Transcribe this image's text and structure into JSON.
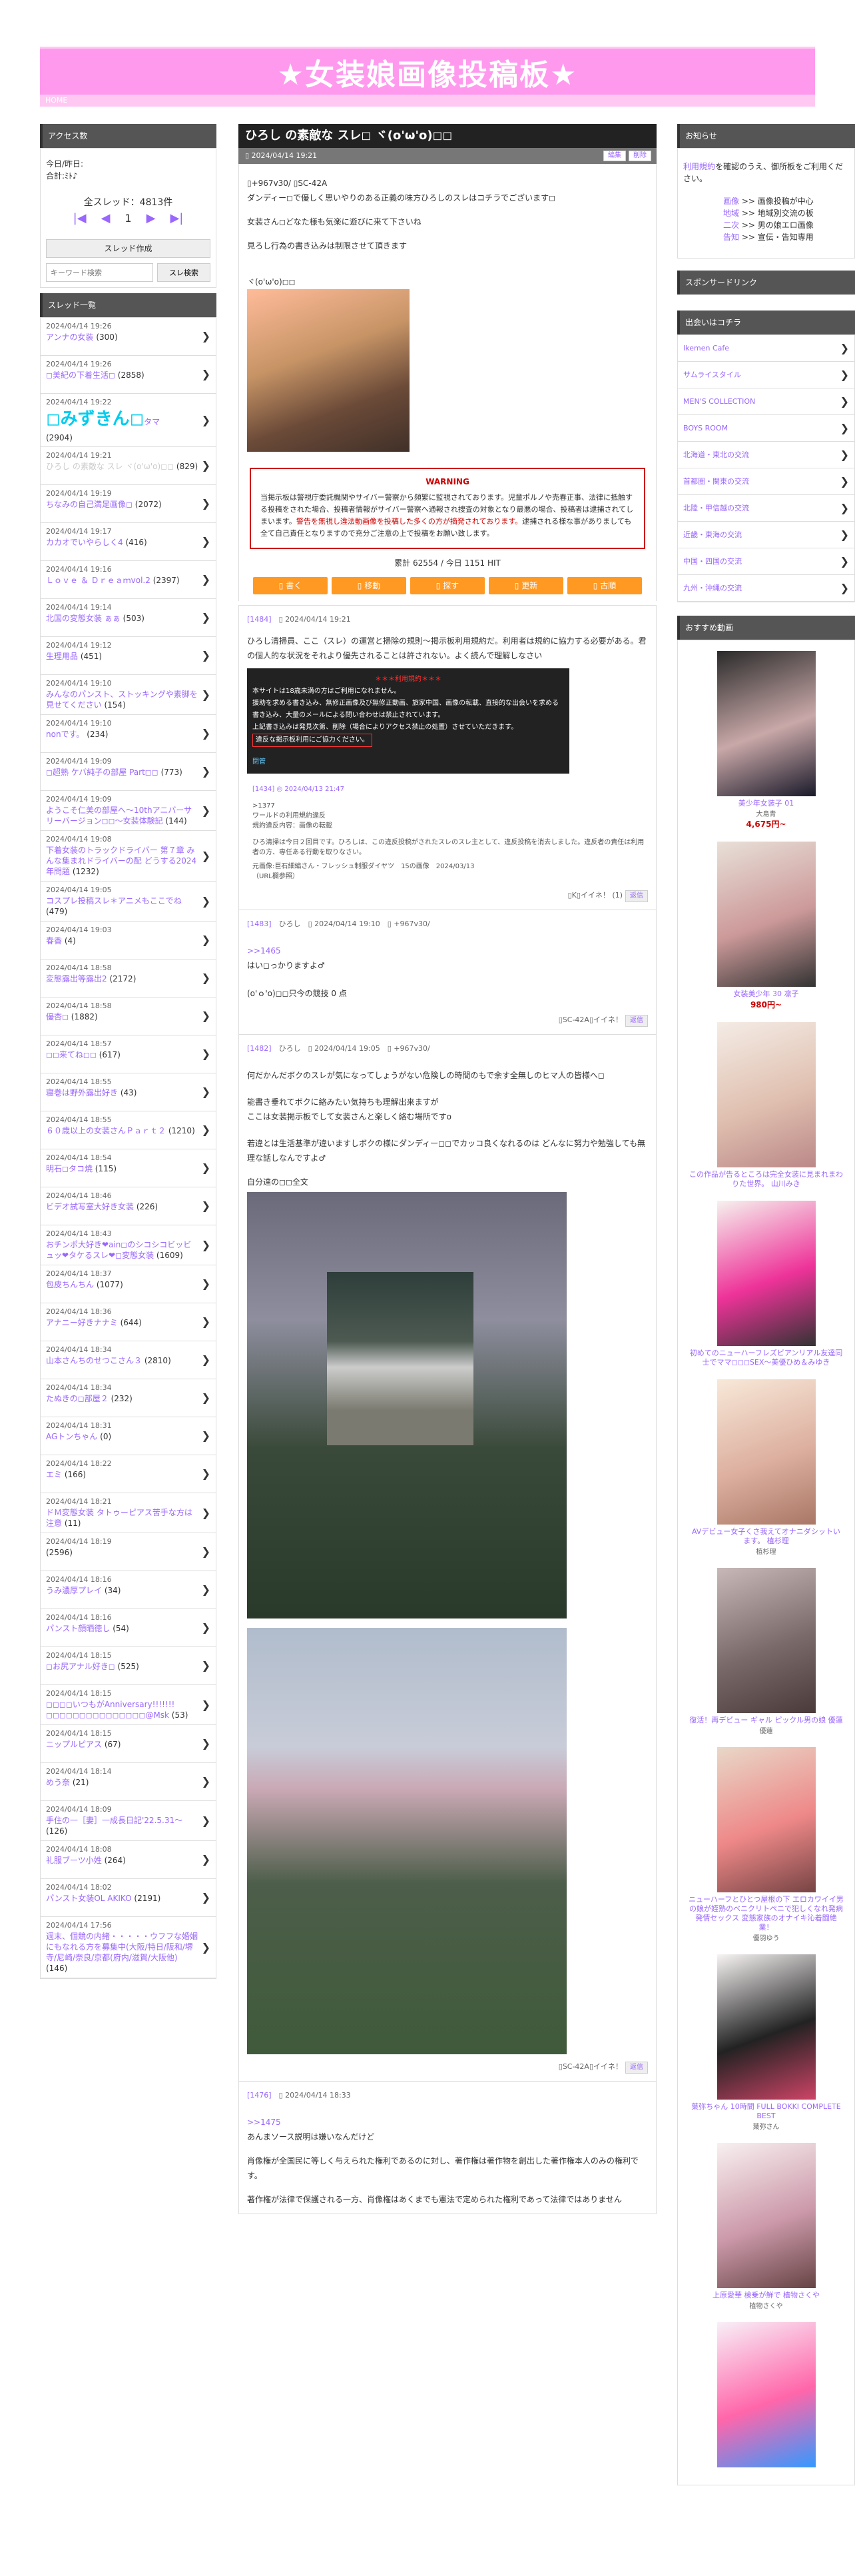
{
  "site": {
    "banner": "★女装娘画像投稿板★",
    "home": "HOME"
  },
  "left": {
    "access_title": "アクセス数",
    "access_today": "今日/昨日:",
    "access_total": "合計:ﾐﾄ♪",
    "all_threads": "全スレッド：4813件",
    "page_num": "1",
    "create_btn": "スレッド作成",
    "search_placeholder": "キーワード検索",
    "search_btn": "スレ検索",
    "list_title": "スレッド一覧",
    "threads": [
      {
        "date": "2024/04/14 19:26",
        "title": "アンナの女装",
        "count": "(300)"
      },
      {
        "date": "2024/04/14 19:26",
        "title": "◻︎美紀の下着生活◻︎",
        "count": "(2858)"
      },
      {
        "date": "2024/04/14 19:22",
        "title": "◻︎みずきん◻︎",
        "title_tail": "タマ",
        "count": "(2904)",
        "big": true
      },
      {
        "date": "2024/04/14 19:21",
        "title": "ひろし の素敵な スレ ヾ(o'ω'o)◻︎◻︎",
        "count": "(829)",
        "grey": true
      },
      {
        "date": "2024/04/14 19:19",
        "title": "ちなみの自己満足画像◻︎",
        "count": "(2072)"
      },
      {
        "date": "2024/04/14 19:17",
        "title": "カカオでいやらしく4",
        "count": "(416)"
      },
      {
        "date": "2024/04/14 19:16",
        "title": "Ｌｏｖｅ ＆ Ｄｒｅａｍvol.2",
        "count": "(2397)"
      },
      {
        "date": "2024/04/14 19:14",
        "title": "北国の変態女装 ぁぁ",
        "count": "(503)"
      },
      {
        "date": "2024/04/14 19:12",
        "title": "生理用品",
        "count": "(451)"
      },
      {
        "date": "2024/04/14 19:10",
        "title": "みんなのパンスト、ストッキングや素脚を見せてください",
        "count": "(154)"
      },
      {
        "date": "2024/04/14 19:10",
        "title": "nonです。",
        "count": "(234)"
      },
      {
        "date": "2024/04/14 19:09",
        "title": "◻︎超熟 ケバ純子の部屋 Part◻︎◻︎",
        "count": "(773)"
      },
      {
        "date": "2024/04/14 19:09",
        "title": "ようこそ仁美の部屋へ〜10thアニバーサリーバージョン◻︎◻︎〜女装体験記",
        "count": "(144)"
      },
      {
        "date": "2024/04/14 19:08",
        "title": "下着女装のトラックドライバー 第７章 みんな集まれドライバーの配 どうする2024年問題",
        "count": "(1232)"
      },
      {
        "date": "2024/04/14 19:05",
        "title": "コスプレ投稿スレ",
        "title_tail": "＊アニメもここでね",
        "count": "(479)"
      },
      {
        "date": "2024/04/14 19:03",
        "title": "春香",
        "count": "(4)"
      },
      {
        "date": "2024/04/14 18:58",
        "title": "変態露出等露出2",
        "count": "(2172)"
      },
      {
        "date": "2024/04/14 18:58",
        "title": "優杏◻︎",
        "count": "(1882)"
      },
      {
        "date": "2024/04/14 18:57",
        "title": "◻︎◻︎来てね◻︎◻︎",
        "count": "(617)"
      },
      {
        "date": "2024/04/14 18:55",
        "title": "寝巻は野外露出好き",
        "count": "(43)"
      },
      {
        "date": "2024/04/14 18:55",
        "title": "６０歳以上の女装さんＰａｒｔ２",
        "count": "(1210)"
      },
      {
        "date": "2024/04/14 18:54",
        "title": "明石◻︎タコ燒",
        "count": "(115)"
      },
      {
        "date": "2024/04/14 18:46",
        "title": "ビデオ試写室大好き女装",
        "count": "(226)"
      },
      {
        "date": "2024/04/14 18:43",
        "title": "おチンポ大好き❤︎ain◻︎のシコシコビッビュッ❤︎タケるスレ❤︎◻︎変態女装",
        "count": "(1609)"
      },
      {
        "date": "2024/04/14 18:37",
        "title": "包皮ちんちん",
        "count": "(1077)"
      },
      {
        "date": "2024/04/14 18:36",
        "title": "アナニー好きナナミ",
        "count": "(644)"
      },
      {
        "date": "2024/04/14 18:34",
        "title": "山本さんちのせつこさん３",
        "count": "(2810)"
      },
      {
        "date": "2024/04/14 18:34",
        "title": "たぬきの◻︎部屋２",
        "count": "(232)"
      },
      {
        "date": "2024/04/14 18:31",
        "title": "AGトンちゃん",
        "count": "(0)"
      },
      {
        "date": "2024/04/14 18:22",
        "title": "エミ",
        "count": "(166)"
      },
      {
        "date": "2024/04/14 18:21",
        "title": "ドＭ変態女装 タトゥーピアス苦手な方は注意",
        "count": "(11)"
      },
      {
        "date": "2024/04/14 18:19",
        "title": "",
        "count": "(2596)"
      },
      {
        "date": "2024/04/14 18:16",
        "title": "うみ濃厚プレイ",
        "count": "(34)"
      },
      {
        "date": "2024/04/14 18:16",
        "title": "パンスト顔晒徳し",
        "count": "(54)"
      },
      {
        "date": "2024/04/14 18:15",
        "title": "◻︎お尻アナル好き◻︎",
        "count": "(525)"
      },
      {
        "date": "2024/04/14 18:15",
        "title": "◻︎◻︎◻︎◻︎いつもがAnniversary!!!!!!!◻︎◻︎◻︎◻︎◻︎◻︎◻︎◻︎◻︎◻︎◻︎◻︎◻︎◻︎◻︎@Msk",
        "count": "(53)"
      },
      {
        "date": "2024/04/14 18:15",
        "title": "ニップルピアス",
        "count": "(67)"
      },
      {
        "date": "2024/04/14 18:14",
        "title": "めう奈",
        "count": "(21)"
      },
      {
        "date": "2024/04/14 18:09",
        "title": "手住の一［妻］一成長日記'22.5.31〜",
        "count": "(126)"
      },
      {
        "date": "2024/04/14 18:08",
        "title": "礼服ブーツ小姓",
        "count": "(264)"
      },
      {
        "date": "2024/04/14 18:02",
        "title": "パンスト女装OL AKIKO",
        "count": "(2191)"
      },
      {
        "date": "2024/04/14 17:56",
        "title": "週末、個競の内緒・・・・・ウフフな婚姻にもなれる方を募集中(大阪/特日/阪和/堺寺/尼崎/奈良/京都(府内/滋賀/大阪他)",
        "count": "(146)"
      }
    ]
  },
  "main": {
    "title": "ひろし の素敵な スレ◻︎ ヾ(o'ω'o)◻︎◻︎",
    "date": "▯ 2024/04/14 19:21",
    "edit": "編集",
    "delete": "削除",
    "op_line1": "▯+967v30/ ▯SC-42A",
    "op_line2": "ダンディー◻︎で優しく思いやりのある正義の味方ひろしのスレはコチラでございます◻︎",
    "op_line3": "女装さん◻︎どなた様も気楽に遊びに来て下さいね",
    "op_line4": "見ろし行為の書き込みは制限させて頂きます",
    "op_line5": "ヾ(o'ω'o)◻︎◻︎",
    "warn_title": "WARNING",
    "warn_body1": "当掲示板は警視庁委託機関やサイバー警察から頻繁に監視されております。児童ポルノや売春正事、法律に抵触する投稿をされた場合、投稿者情報がサイバー警察へ通報され捜査の対象となり最悪の場合、投稿者は逮捕されてしまいます。",
    "warn_body2": "警告を無視し違法動画像を投稿した多くの方が摘発されております。",
    "warn_body3": "逮捕される様な事がありましても全て自己責任となりますので充分ご注意の上で投稿をお願い致します。",
    "hits": "累計 62554 / 今日 1151 HIT",
    "actions": [
      "▯ 書く",
      "▯ 移動",
      "▯ 探す",
      "▯ 更新",
      "▯ 古順"
    ],
    "res": [
      {
        "num": "[1484]",
        "date": "▯ 2024/04/14 19:21",
        "body1": "ひろし清掃員、ここ（スレ）の運営と掃除の規則〜掲示板利用規約だ。利用者は規約に協力する必要がある。君の個人的な状況をそれより優先されることは許されない。よく読んで理解しなさい",
        "dark_h": "＊＊＊利用規約＊＊＊",
        "dark1": "本サイトは18歳未満の方はご利用になれません。",
        "dark2": "援助を求める書き込み、無修正画像及び無修正動画、旅家中国、画像の転載、直接的な出会いを求める書き込み、大量のメールによる問い合わせは禁止されています。",
        "dark3": "上記書き込みは発見次第、削除（場合によりアクセス禁止の処置）させていただきます。",
        "dark_box": "違反な掲示板利用にご協力ください。",
        "dark_link": "閉管",
        "dark_date": "[1434]  ◎ 2024/04/13 21:47",
        "quote1": ">1377",
        "quote2": "ワールドの利用規約違反",
        "quote3": "規約違反内容：画像の転載",
        "quote4": "ひろ清掃は今日２回目です。ひろしは、この違反投稿がされたスレのスレ主として、違反投稿を消去しました。違反者の責任は利用者の方、専任ある行動を取りなさい。",
        "quote5": "元画像:巨石細編さん・フレッシュ制服ダイヤツ　15の画像　2024/03/13",
        "quote6": "（URL欄参照）",
        "foot": "▯K▯イイネ！",
        "foot_count": "(1)",
        "reply": "返信"
      },
      {
        "num": "[1483]",
        "meta": "ひろし　▯ 2024/04/14 19:10　▯ +967v30/",
        "anchor": ">>1465",
        "body1": "はい◻︎っかりますよ♂",
        "body2": "(o'ｏ'o)◻︎◻︎只今の競技 0 点",
        "foot": "▯SC-42A▯イイネ！",
        "reply": "返信"
      },
      {
        "num": "[1482]",
        "meta": "ひろし　▯ 2024/04/14 19:05　▯ +967v30/",
        "body1": "何だかんだボクのスレが気になってしょうがない危険しの時間のもで余す全無しのヒマ人の皆様へ◻︎",
        "body2": "能書き垂れてボクに絡みたい気持ちも理解出来ますが",
        "body3": "ここは女装掲示板でして女装さんと楽しく絡む場所ですo",
        "body4": "若違とは生活基準が違いますしボクの様にダンディー◻︎◻︎でカッコ良くなれるのは どんなに努力や勉強しても無理な話しなんですよ♂",
        "body5": "自分達の◻︎◻︎全文",
        "foot": "▯SC-42A▯イイネ！",
        "reply": "返信"
      },
      {
        "num": "[1476]",
        "date": "▯ 2024/04/14 18:33",
        "anchor": ">>1475",
        "body1": "あんまソース説明は嫌いなんだけど",
        "body2": "肖像権が全国民に等しく与えられた権利であるのに対し、著作権は著作物を創出した著作権本人のみの権利です。",
        "body3": "著作権が法律で保護される一方、肖像権はあくまでも憲法で定められた権利であって法律ではありません"
      }
    ]
  },
  "right": {
    "notice_title": "お知らせ",
    "notice1": "利用規約",
    "notice2": "を確認のうえ、御所板をご利用ください。",
    "links": [
      {
        "k": "画像",
        "v": "画像投稿が中心"
      },
      {
        "k": "地域",
        "v": "地域別交流の板"
      },
      {
        "k": "二次",
        "v": "男の娘エロ画像"
      },
      {
        "k": "告知",
        "v": "宣伝・告知専用"
      }
    ],
    "sponsor_title": "スポンサードリンク",
    "deai_title": "出会いはコチラ",
    "deai": [
      "Ikemen Cafe",
      "サムライスタイル",
      "MEN'S COLLECTION",
      "BOYS ROOM",
      "北海道・東北の交流",
      "首都圏・関東の交流",
      "北陸・甲信越の交流",
      "近畿・東海の交流",
      "中国・四国の交流",
      "九州・沖縄の交流"
    ],
    "video_title": "おすすめ動画",
    "videos": [
      {
        "title": "美少年女装子 01",
        "name": "大島青",
        "price": "4,675円~"
      },
      {
        "title": "女装美少年 30 凛子",
        "name": "",
        "price": "980円~"
      },
      {
        "title": "この作品が告るところは完全女装に見まれまわりた世界。 山川みき",
        "name": "",
        "price": ""
      },
      {
        "title": "初めてのニューハーフレズビアンリアル友達同士でママ◻︎◻︎◻︎SEX〜美優ひめ＆みゆき",
        "name": "",
        "price": ""
      },
      {
        "title": "AVデビュー女子くさ我えてオナニダシットいます。 植杉理",
        "name": "植杉理",
        "price": ""
      },
      {
        "title": "復活！再デビュー ギャル ピックル男の娘 優蓮",
        "name": "優蓮",
        "price": ""
      },
      {
        "title": "ニューハーフとひとつ屋根の下 エロカワイイ男の娘が姪熟のベニクリトペニで犯しくなれ発病発情セックス 変態家族のオナイキ沁着闘絶業！",
        "name": "優羽ゆう",
        "price": ""
      },
      {
        "title": "葉弥ちゃん 10時間 FULL BOKKI COMPLETE BEST",
        "name": "葉弥さん",
        "price": ""
      },
      {
        "title": "上原愛華 検乗が鮮で 植物さくや",
        "name": "植物さくや",
        "price": ""
      },
      {
        "title": "",
        "name": "",
        "price": ""
      }
    ]
  },
  "colors": {
    "banner": "#ff99ee",
    "accent": "#9966ff",
    "orange": "#ff9922",
    "warning": "#cc0000"
  }
}
